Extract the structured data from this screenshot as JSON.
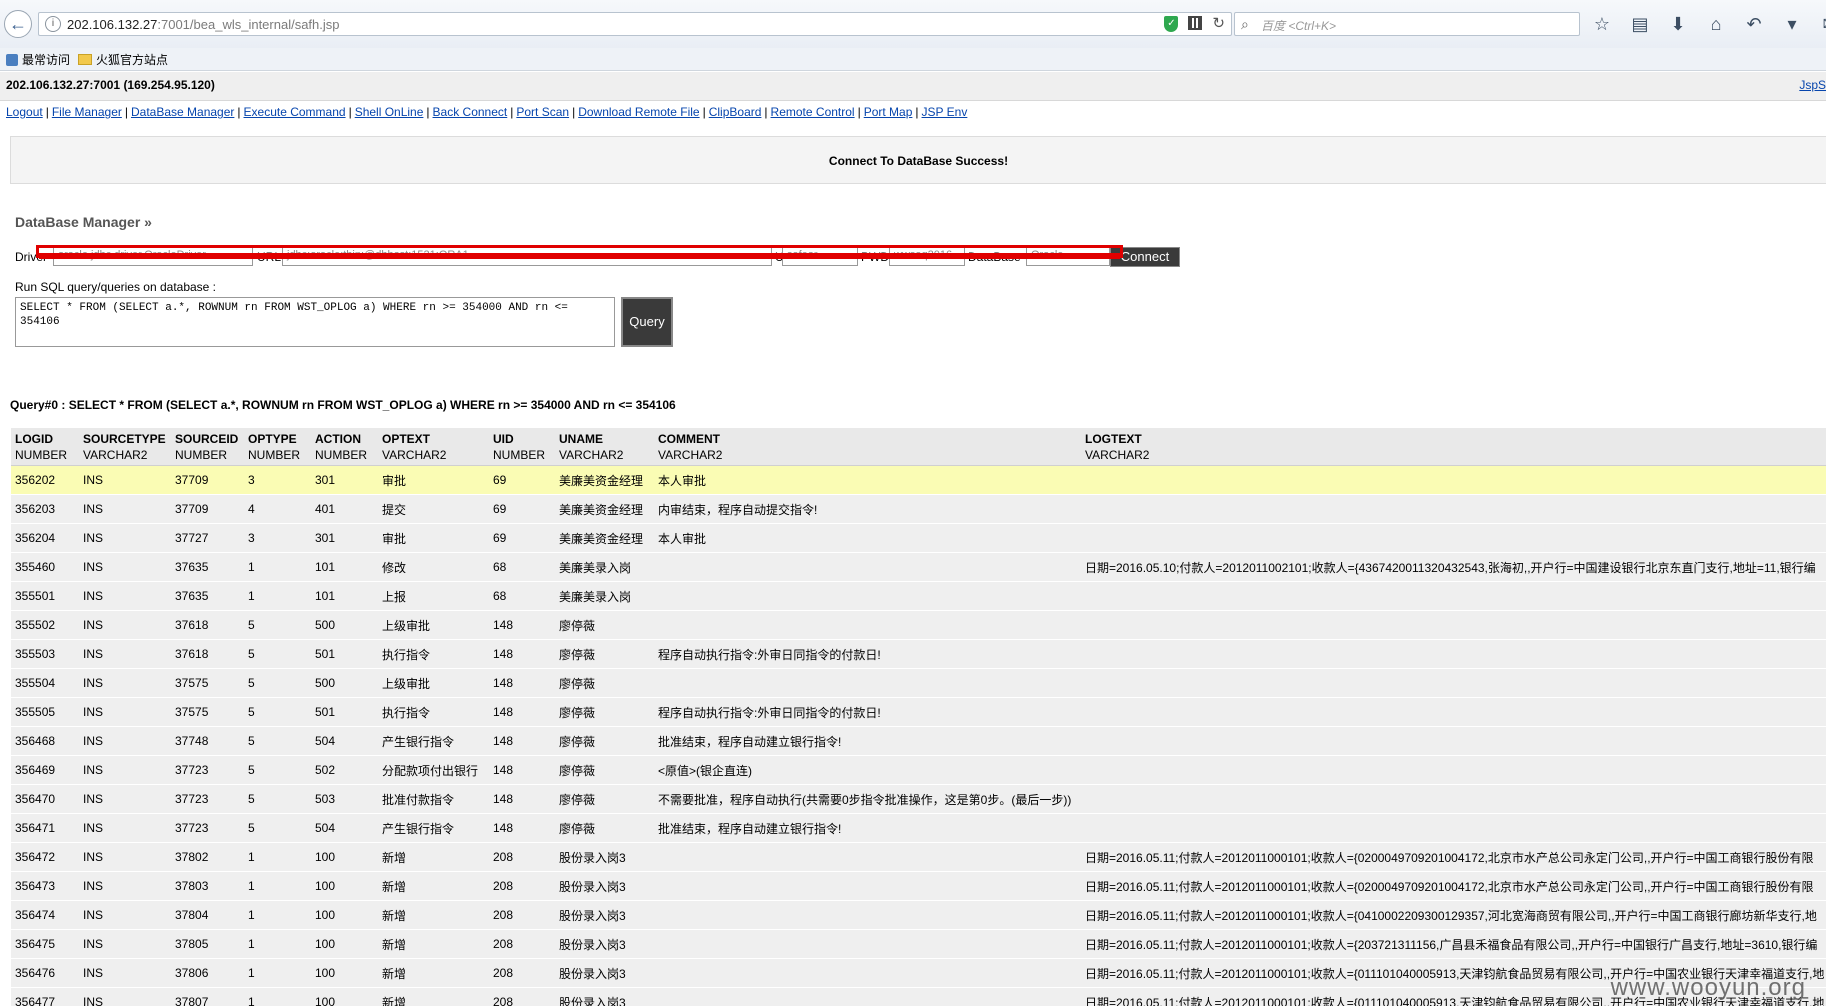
{
  "browser": {
    "url_host": "202.106.132.27",
    "url_rest": ":7001/bea_wls_internal/safh.jsp",
    "search_placeholder": "百度 <Ctrl+K>",
    "bookmarks": [
      "最常访问",
      "火狐官方站点"
    ]
  },
  "page": {
    "host_info": "202.106.132.27:7001 (169.254.95.120)",
    "corner_link": "JspS",
    "menu": [
      "Logout",
      "File Manager",
      "DataBase Manager",
      "Execute Command",
      "Shell OnLine",
      "Back Connect",
      "Port Scan",
      "Download Remote File",
      "ClipBoard",
      "Remote Control",
      "Port Map",
      "JSP Env"
    ],
    "success_message": "Connect To DataBase Success!",
    "section_title": "DataBase Manager »",
    "conn": {
      "driver_label": "Driver",
      "driver_value": "oracle.jdbc.driver.OracleDriver",
      "url_label": "URL",
      "url_value": "jdbc:oracle:thin:@dbhost:1521:ORA1",
      "uid_label": "UID",
      "uid_value": "safeor",
      "pwd_label": "PWD",
      "pwd_value": "wwsaq2016",
      "db_label": "DataBase",
      "db_value": "Oracle",
      "connect_label": "Connect"
    },
    "sql_label": "Run SQL query/queries on database :",
    "sql_text": "SELECT * FROM (SELECT a.*, ROWNUM rn FROM WST_OPLOG a) WHERE rn >= 354000 AND rn <= 354106",
    "query_button": "Query",
    "query_line": "Query#0 : SELECT * FROM (SELECT a.*, ROWNUM rn FROM WST_OPLOG a) WHERE rn >= 354000 AND rn <= 354106"
  },
  "table": {
    "headers": [
      {
        "name": "LOGID",
        "type": "NUMBER"
      },
      {
        "name": "SOURCETYPE",
        "type": "VARCHAR2"
      },
      {
        "name": "SOURCEID",
        "type": "NUMBER"
      },
      {
        "name": "OPTYPE",
        "type": "NUMBER"
      },
      {
        "name": "ACTION",
        "type": "NUMBER"
      },
      {
        "name": "OPTEXT",
        "type": "VARCHAR2"
      },
      {
        "name": "UID",
        "type": "NUMBER"
      },
      {
        "name": "UNAME",
        "type": "VARCHAR2"
      },
      {
        "name": "COMMENT",
        "type": "VARCHAR2"
      },
      {
        "name": "LOGTEXT",
        "type": "VARCHAR2"
      }
    ],
    "rows": [
      [
        "356202",
        "INS",
        "37709",
        "3",
        "301",
        "审批",
        "69",
        "美廉美资金经理",
        "本人审批",
        ""
      ],
      [
        "356203",
        "INS",
        "37709",
        "4",
        "401",
        "提交",
        "69",
        "美廉美资金经理",
        "内审结束，程序自动提交指令!",
        ""
      ],
      [
        "356204",
        "INS",
        "37727",
        "3",
        "301",
        "审批",
        "69",
        "美廉美资金经理",
        "本人审批",
        ""
      ],
      [
        "355460",
        "INS",
        "37635",
        "1",
        "101",
        "修改",
        "68",
        "美廉美录入岗",
        "",
        "日期=2016.05.10;付款人=2012011002101;收款人={4367420011320432543,张海初,,开户行=中国建设银行北京东直门支行,地址=11,银行编"
      ],
      [
        "355501",
        "INS",
        "37635",
        "1",
        "101",
        "上报",
        "68",
        "美廉美录入岗",
        "",
        ""
      ],
      [
        "355502",
        "INS",
        "37618",
        "5",
        "500",
        "上级审批",
        "148",
        "廖停薇",
        "",
        ""
      ],
      [
        "355503",
        "INS",
        "37618",
        "5",
        "501",
        "执行指令",
        "148",
        "廖停薇",
        "程序自动执行指令:外审日同指令的付款日!",
        ""
      ],
      [
        "355504",
        "INS",
        "37575",
        "5",
        "500",
        "上级审批",
        "148",
        "廖停薇",
        "",
        ""
      ],
      [
        "355505",
        "INS",
        "37575",
        "5",
        "501",
        "执行指令",
        "148",
        "廖停薇",
        "程序自动执行指令:外审日同指令的付款日!",
        ""
      ],
      [
        "356468",
        "INS",
        "37748",
        "5",
        "504",
        "产生银行指令",
        "148",
        "廖停薇",
        "批准结束，程序自动建立银行指令!",
        ""
      ],
      [
        "356469",
        "INS",
        "37723",
        "5",
        "502",
        "分配款项付出银行",
        "148",
        "廖停薇",
        "<原值>(银企直连)",
        ""
      ],
      [
        "356470",
        "INS",
        "37723",
        "5",
        "503",
        "批准付款指令",
        "148",
        "廖停薇",
        "不需要批准，程序自动执行(共需要0步指令批准操作，这是第0步。(最后一步))",
        ""
      ],
      [
        "356471",
        "INS",
        "37723",
        "5",
        "504",
        "产生银行指令",
        "148",
        "廖停薇",
        "批准结束，程序自动建立银行指令!",
        ""
      ],
      [
        "356472",
        "INS",
        "37802",
        "1",
        "100",
        "新增",
        "208",
        "股份录入岗3",
        "",
        "日期=2016.05.11;付款人=2012011000101;收款人={0200049709201004172,北京市水产总公司永定门公司,,开户行=中国工商银行股份有限"
      ],
      [
        "356473",
        "INS",
        "37803",
        "1",
        "100",
        "新增",
        "208",
        "股份录入岗3",
        "",
        "日期=2016.05.11;付款人=2012011000101;收款人={0200049709201004172,北京市水产总公司永定门公司,,开户行=中国工商银行股份有限"
      ],
      [
        "356474",
        "INS",
        "37804",
        "1",
        "100",
        "新增",
        "208",
        "股份录入岗3",
        "",
        "日期=2016.05.11;付款人=2012011000101;收款人={0410002209300129357,河北宽海商贸有限公司,,开户行=中国工商银行廊坊新华支行,地"
      ],
      [
        "356475",
        "INS",
        "37805",
        "1",
        "100",
        "新增",
        "208",
        "股份录入岗3",
        "",
        "日期=2016.05.11;付款人=2012011000101;收款人={203721311156,广昌县禾福食品有限公司,,开户行=中国银行广昌支行,地址=3610,银行编"
      ],
      [
        "356476",
        "INS",
        "37806",
        "1",
        "100",
        "新增",
        "208",
        "股份录入岗3",
        "",
        "日期=2016.05.11;付款人=2012011000101;收款人={011101040005913,天津钧航食品贸易有限公司,,开户行=中国农业银行天津幸福道支行,地"
      ],
      [
        "356477",
        "INS",
        "37807",
        "1",
        "100",
        "新增",
        "208",
        "股份录入岗3",
        "",
        "日期=2016.05.11;付款人=2012011000101;收款人={011101040005913,天津钧航食品贸易有限公司,,开户行=中国农业银行天津幸福道支行,地"
      ]
    ],
    "highlight_row_index": 0
  },
  "watermark": "www.wooyun.org",
  "colors": {
    "highlight_row": "#fafcb4",
    "row_bg": "#efefef",
    "link": "#0645ad",
    "redaction": "#e00000"
  }
}
